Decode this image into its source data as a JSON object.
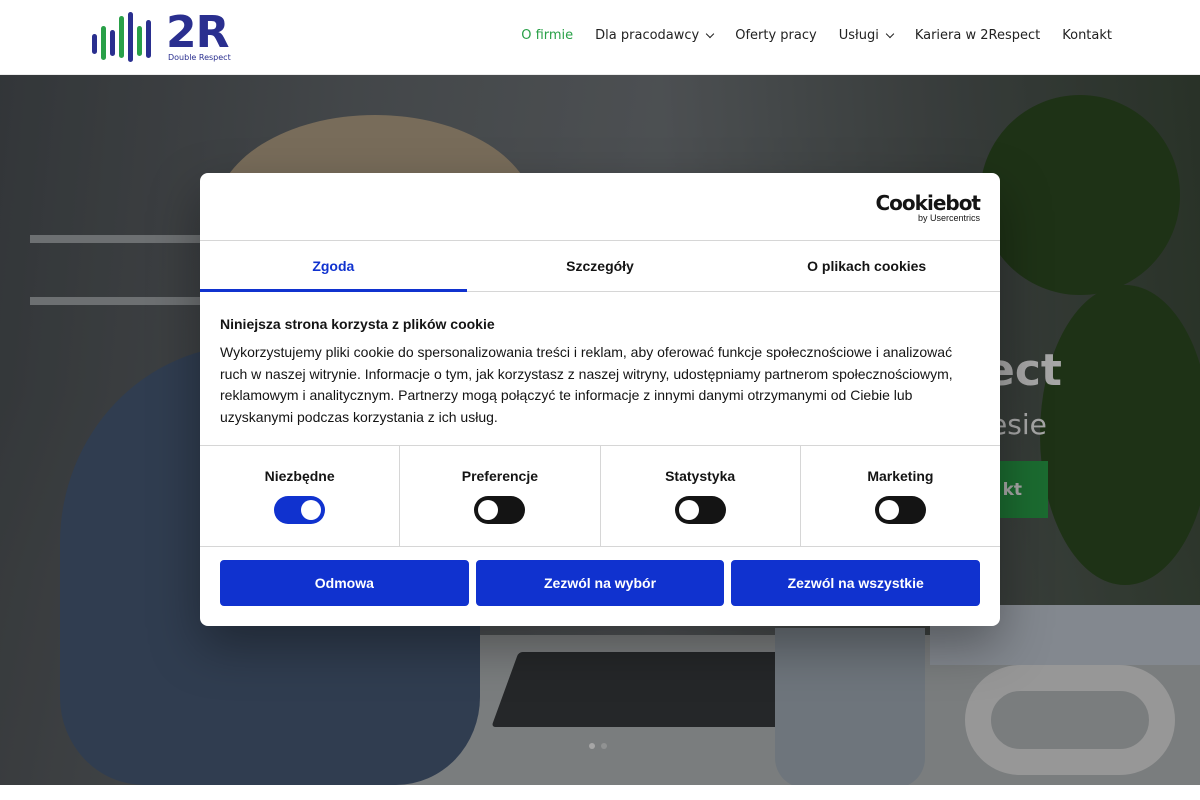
{
  "header": {
    "logo_text": "2R",
    "logo_subtitle": "Double Respect",
    "nav": [
      {
        "label": "O firmie",
        "active": true,
        "dropdown": false
      },
      {
        "label": "Dla pracodawcy",
        "active": false,
        "dropdown": true
      },
      {
        "label": "Oferty pracy",
        "active": false,
        "dropdown": false
      },
      {
        "label": "Usługi",
        "active": false,
        "dropdown": true
      },
      {
        "label": "Kariera w 2Respect",
        "active": false,
        "dropdown": false
      },
      {
        "label": "Kontakt",
        "active": false,
        "dropdown": false
      }
    ]
  },
  "hero": {
    "title_fragment": "ect",
    "subtitle_fragment": "esie",
    "cta_fragment": "kt",
    "slides": 2,
    "active_slide": 1
  },
  "cookie_dialog": {
    "brand": "Cookiebot",
    "brand_by": "by Usercentrics",
    "tabs": [
      {
        "label": "Zgoda",
        "active": true
      },
      {
        "label": "Szczegóły",
        "active": false
      },
      {
        "label": "O plikach cookies",
        "active": false
      }
    ],
    "title": "Niniejsza strona korzysta z plików cookie",
    "text": "Wykorzystujemy pliki cookie do spersonalizowania treści i reklam, aby oferować funkcje społecznościowe i analizować ruch w naszej witrynie. Informacje o tym, jak korzystasz z naszej witryny, udostępniamy partnerom społecznościowym, reklamowym i analitycznym. Partnerzy mogą połączyć te informacje z innymi danymi otrzymanymi od Ciebie lub uzyskanymi podczas korzystania z ich usług.",
    "categories": [
      {
        "label": "Niezbędne",
        "enabled": true
      },
      {
        "label": "Preferencje",
        "enabled": false
      },
      {
        "label": "Statystyka",
        "enabled": false
      },
      {
        "label": "Marketing",
        "enabled": false
      }
    ],
    "buttons": {
      "deny": "Odmowa",
      "allow_selection": "Zezwól na wybór",
      "allow_all": "Zezwól na wszystkie"
    }
  },
  "colors": {
    "brand_blue": "#2a2f8f",
    "brand_green": "#29a048",
    "cookie_blue": "#1032cf"
  }
}
